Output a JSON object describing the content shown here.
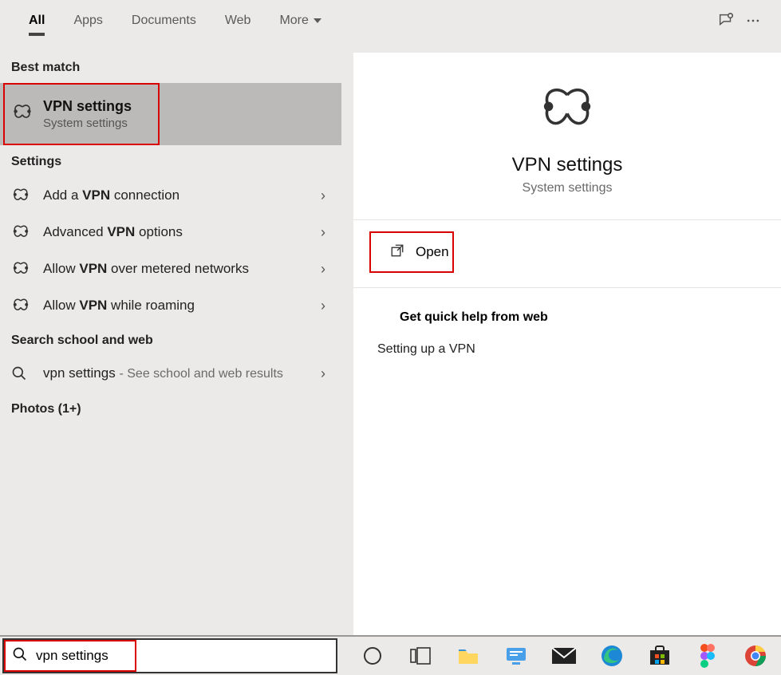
{
  "tabs": [
    "All",
    "Apps",
    "Documents",
    "Web",
    "More"
  ],
  "active_tab_index": 0,
  "sections": {
    "best_match": "Best match",
    "settings": "Settings",
    "school_web": "Search school and web",
    "photos": "Photos (1+)"
  },
  "best_match": {
    "title": "VPN settings",
    "subtitle": "System settings"
  },
  "settings_results": [
    {
      "prefix": "Add a ",
      "bold": "VPN",
      "suffix": " connection"
    },
    {
      "prefix": "Advanced ",
      "bold": "VPN",
      "suffix": " options"
    },
    {
      "prefix": "Allow ",
      "bold": "VPN",
      "suffix": " over metered networks"
    },
    {
      "prefix": "Allow ",
      "bold": "VPN",
      "suffix": " while roaming"
    }
  ],
  "web_result": {
    "query": "vpn settings",
    "hint": "See school and web results"
  },
  "detail": {
    "title": "VPN settings",
    "subtitle": "System settings",
    "open_label": "Open",
    "quick_help_header": "Get quick help from web",
    "quick_links": [
      "Setting up a VPN"
    ]
  },
  "search_value": "vpn settings",
  "taskbar_apps": [
    "cortana",
    "task-view",
    "file-explorer",
    "remote-desktop",
    "mail",
    "edge",
    "microsoft-store",
    "figma",
    "chrome"
  ]
}
